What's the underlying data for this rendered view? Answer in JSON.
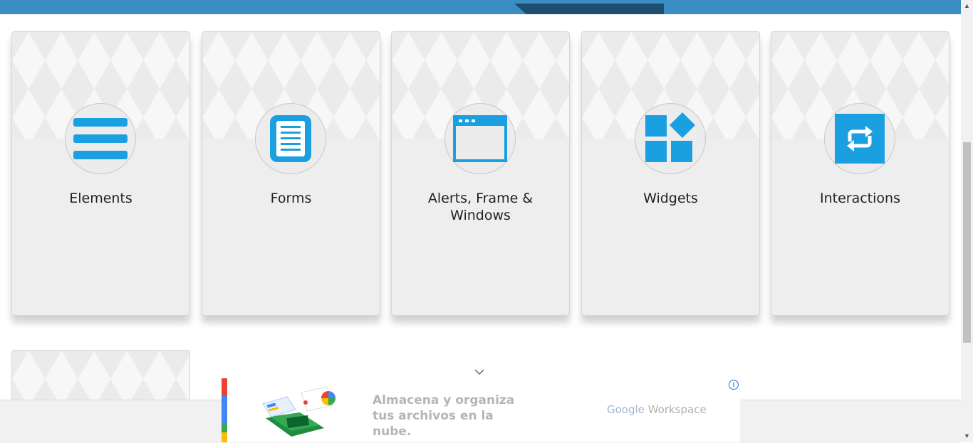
{
  "cards": [
    {
      "title": "Elements",
      "icon": "list-icon"
    },
    {
      "title": "Forms",
      "icon": "document-icon"
    },
    {
      "title": "Alerts, Frame & Windows",
      "icon": "window-icon"
    },
    {
      "title": "Widgets",
      "icon": "widgets-icon"
    },
    {
      "title": "Interactions",
      "icon": "repeat-icon"
    }
  ],
  "ad": {
    "headline": "Almacena y organiza tus archivos en la nube.",
    "brand_google": "Google",
    "brand_workspace": "Workspace",
    "info_glyph": "i"
  },
  "colors": {
    "accent": "#1a9fe0",
    "topbar": "#3b8ec5",
    "topbar_tab": "#1f4f70"
  }
}
